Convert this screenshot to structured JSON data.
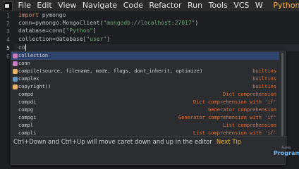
{
  "menu": {
    "items": [
      "File",
      "Edit",
      "View",
      "Navigate",
      "Code",
      "Refactor",
      "Run",
      "Tools",
      "VCS",
      "W"
    ],
    "project": "PythonBootcamp"
  },
  "editor": {
    "line_numbers": [
      "1",
      "2",
      "3",
      "4",
      "5",
      "6"
    ],
    "lines": {
      "l1": {
        "kw": "import",
        "rest": " pymongo"
      },
      "l2": {
        "pre": "conn=pymongo.MongoClient(",
        "str": "\"mongodb://localhost:27017\"",
        "post": ")"
      },
      "l3": {
        "pre": "database=conn[",
        "str": "\"Python\"",
        "post": "]"
      },
      "l4": {
        "pre": "collection=database[",
        "str": "\"user\"",
        "post": "]"
      },
      "l5": {
        "text": "co"
      }
    }
  },
  "completion": {
    "items": [
      {
        "name": "collection",
        "tail": "",
        "icon_color": "#c77dbb"
      },
      {
        "name": "conn",
        "tail": "",
        "icon_color": "#c77dbb"
      },
      {
        "name": "compile(source, filename, mode, flags, dont_inherit, optimize)",
        "tail": "builtins",
        "icon_color": "#e8b56b"
      },
      {
        "name": "complex",
        "tail": "builtins",
        "icon_color": "#6897bb"
      },
      {
        "name": "copyright()",
        "tail": "builtins",
        "icon_color": "#e8b56b"
      },
      {
        "name": "compd",
        "tail": "Dict comprehension",
        "icon_color": ""
      },
      {
        "name": "compdi",
        "tail": "Dict comprehension with 'if'",
        "icon_color": ""
      },
      {
        "name": "compg",
        "tail": "Generator comprehension",
        "icon_color": ""
      },
      {
        "name": "compgi",
        "tail": "Generator comprehension with 'if'",
        "icon_color": ""
      },
      {
        "name": "compl",
        "tail": "List comprehension",
        "icon_color": ""
      },
      {
        "name": "compli",
        "tail": "List comprehension with 'if'",
        "icon_color": ""
      }
    ],
    "hint": "Ctrl+Down and Ctrl+Up will move caret down and up in the editor",
    "next_tip": "Next Tip"
  },
  "brand": {
    "top": "Funky",
    "name": "Programmer"
  }
}
